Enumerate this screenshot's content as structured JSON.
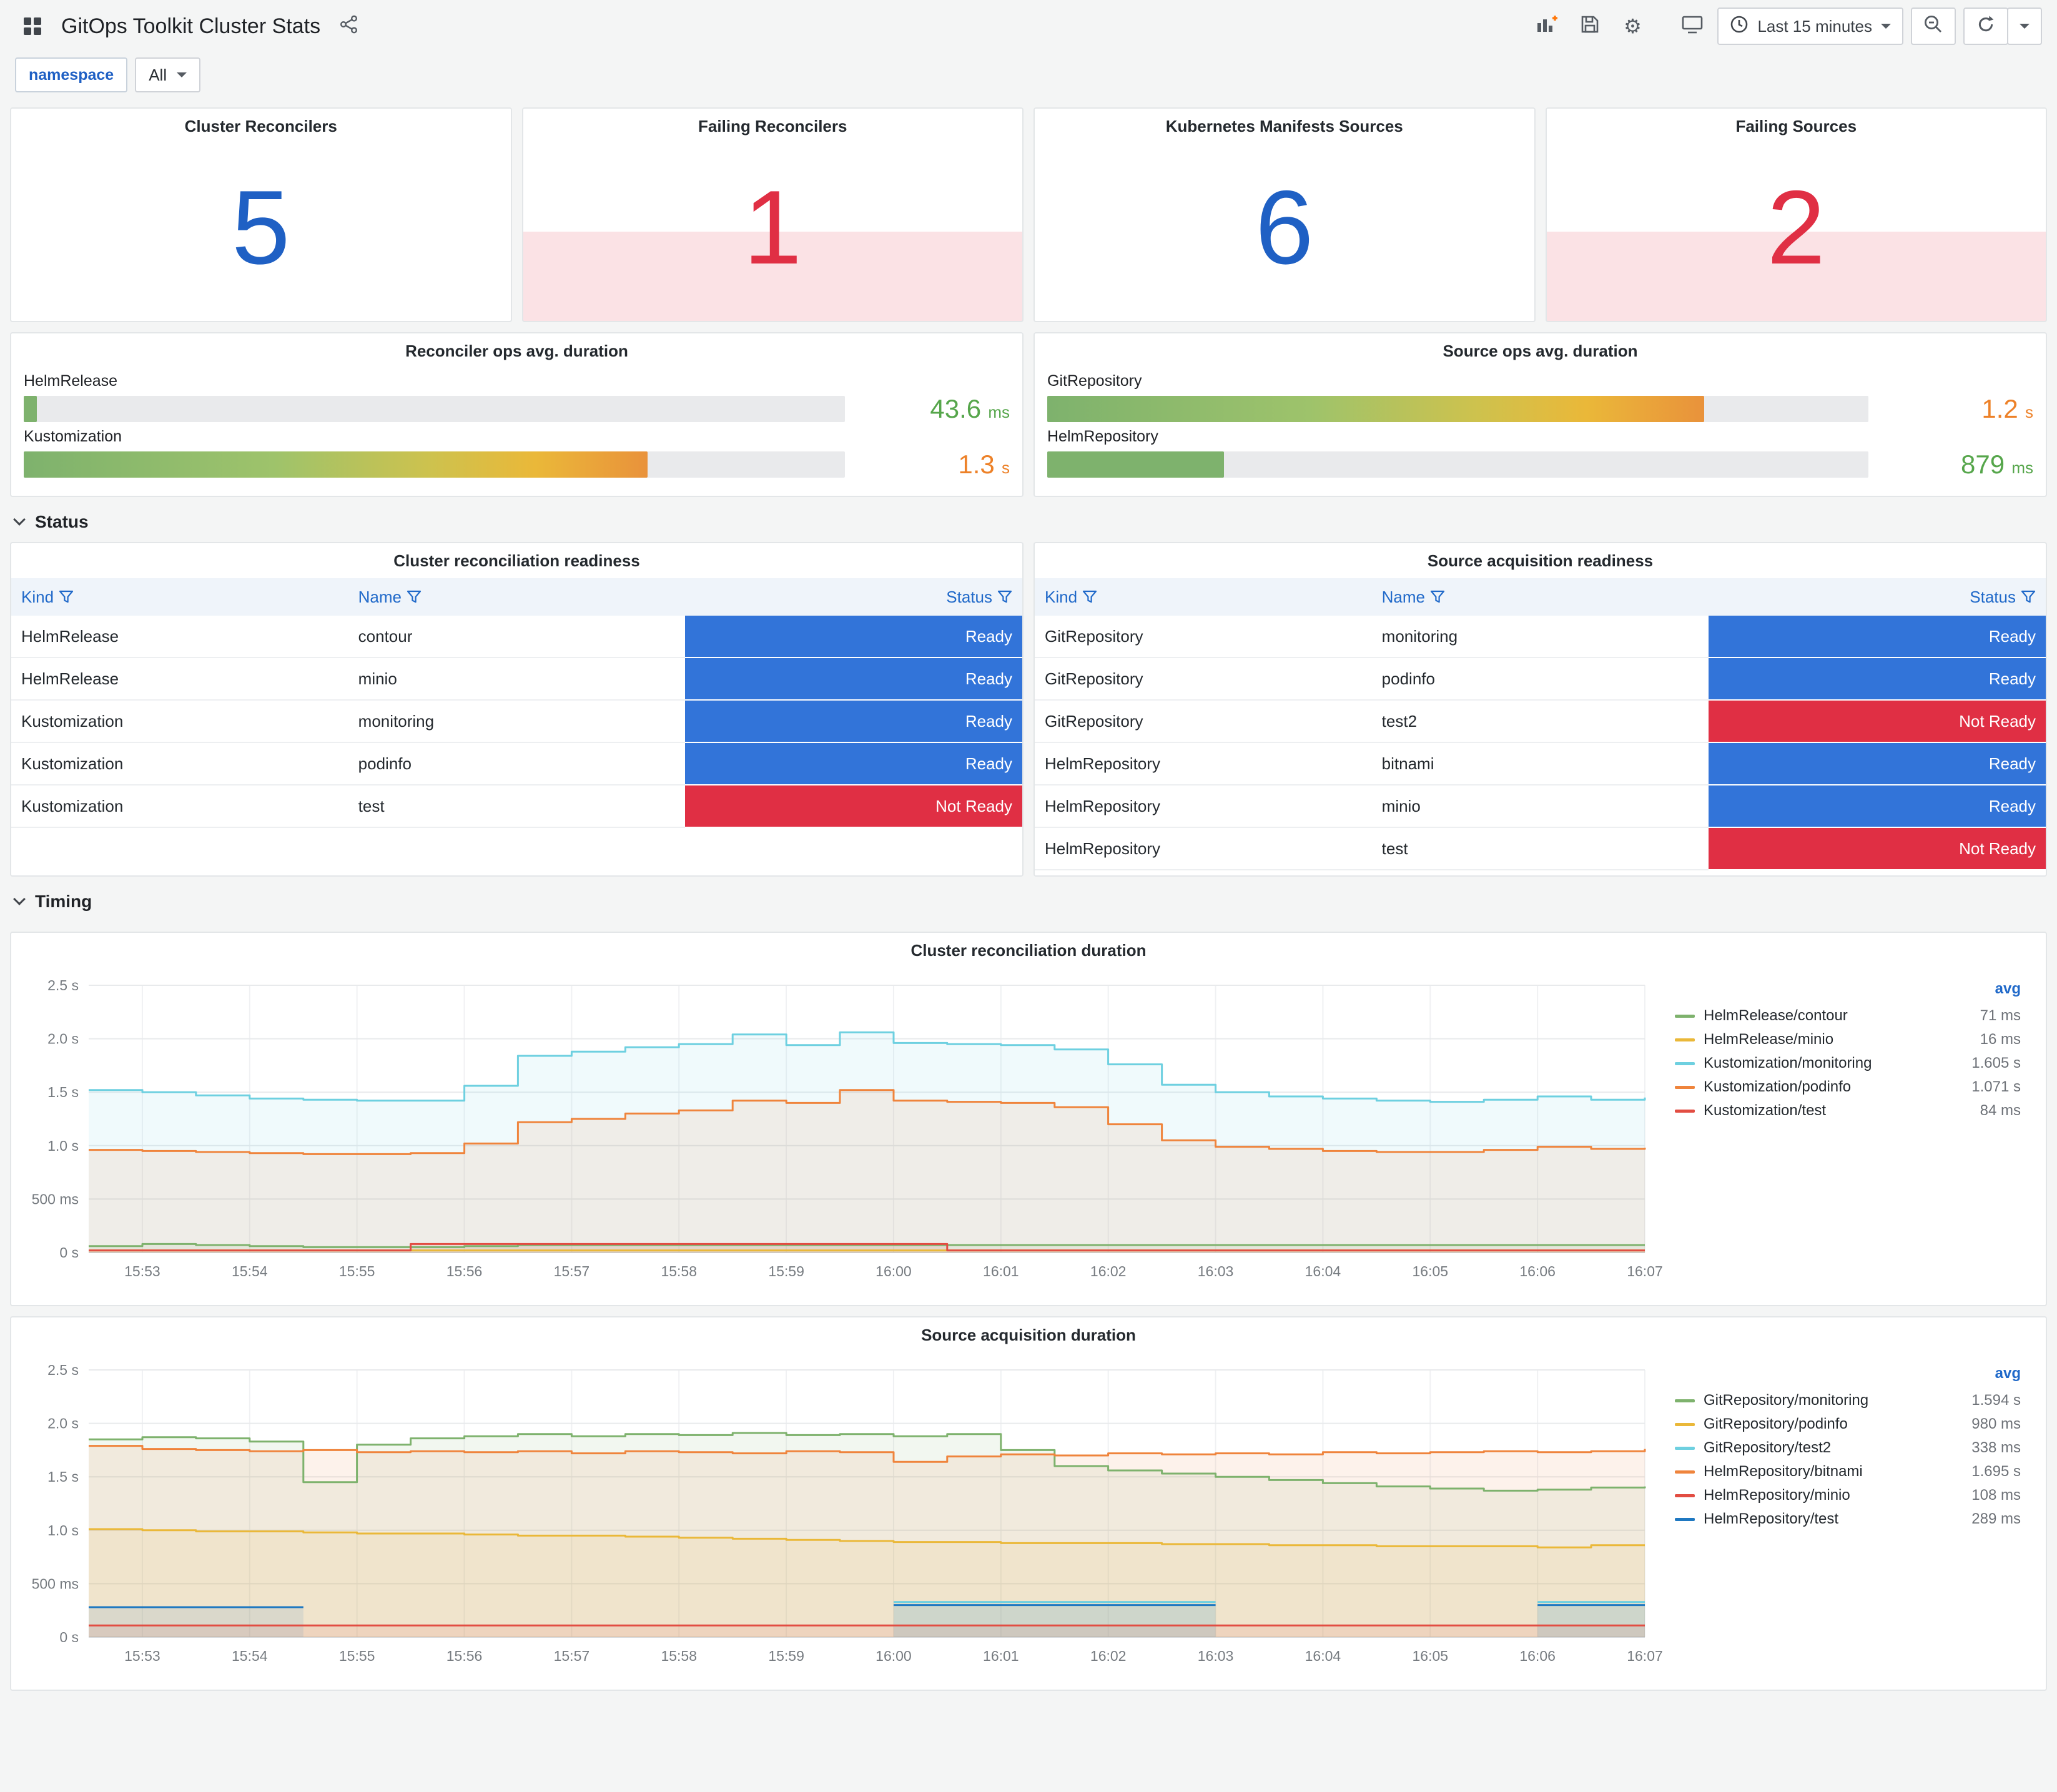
{
  "header": {
    "title": "GitOps Toolkit Cluster Stats",
    "time_picker": "Last 15 minutes"
  },
  "variables": {
    "namespace_label": "namespace",
    "namespace_value": "All"
  },
  "colors": {
    "accent_blue": "#1F60C4",
    "alert_red": "#E02F44",
    "ready_bg": "#3274D9",
    "not_ready_bg": "#E02F44",
    "value_green": "#56A64B",
    "value_orange": "#ED8128",
    "alert_band": "rgba(224,47,68,0.14)"
  },
  "stats": [
    {
      "title": "Cluster Reconcilers",
      "value": "5",
      "state": "ok"
    },
    {
      "title": "Failing Reconcilers",
      "value": "1",
      "state": "alert"
    },
    {
      "title": "Kubernetes Manifests Sources",
      "value": "6",
      "state": "ok"
    },
    {
      "title": "Failing Sources",
      "value": "2",
      "state": "alert"
    }
  ],
  "gauges": [
    {
      "title": "Reconciler ops avg. duration",
      "rows": [
        {
          "label": "HelmRelease",
          "value": "43.6",
          "unit": "ms",
          "pct": 1.6,
          "bar": "green",
          "value_color": "green"
        },
        {
          "label": "Kustomization",
          "value": "1.3",
          "unit": "s",
          "pct": 76,
          "bar": "grad",
          "value_color": "orange"
        }
      ]
    },
    {
      "title": "Source ops avg. duration",
      "rows": [
        {
          "label": "GitRepository",
          "value": "1.2",
          "unit": "s",
          "pct": 80,
          "bar": "grad",
          "value_color": "orange"
        },
        {
          "label": "HelmRepository",
          "value": "879",
          "unit": "ms",
          "pct": 21.5,
          "bar": "green",
          "value_color": "green"
        }
      ]
    }
  ],
  "sections": {
    "status": "Status",
    "timing": "Timing"
  },
  "tables": [
    {
      "title": "Cluster reconciliation readiness",
      "columns": [
        "Kind",
        "Name",
        "Status"
      ],
      "rows": [
        [
          "HelmRelease",
          "contour",
          "Ready"
        ],
        [
          "HelmRelease",
          "minio",
          "Ready"
        ],
        [
          "Kustomization",
          "monitoring",
          "Ready"
        ],
        [
          "Kustomization",
          "podinfo",
          "Ready"
        ],
        [
          "Kustomization",
          "test",
          "Not Ready"
        ]
      ]
    },
    {
      "title": "Source acquisition readiness",
      "columns": [
        "Kind",
        "Name",
        "Status"
      ],
      "rows": [
        [
          "GitRepository",
          "monitoring",
          "Ready"
        ],
        [
          "GitRepository",
          "podinfo",
          "Ready"
        ],
        [
          "GitRepository",
          "test2",
          "Not Ready"
        ],
        [
          "HelmRepository",
          "bitnami",
          "Ready"
        ],
        [
          "HelmRepository",
          "minio",
          "Ready"
        ],
        [
          "HelmRepository",
          "test",
          "Not Ready"
        ]
      ]
    }
  ],
  "chart_data": [
    {
      "type": "line",
      "title": "Cluster reconciliation duration",
      "y_unit": "seconds",
      "ylim": [
        0,
        2.5
      ],
      "ytick_values": [
        0,
        0.5,
        1.0,
        1.5,
        2.0,
        2.5
      ],
      "ytick_labels": [
        "0 s",
        "500 ms",
        "1.0 s",
        "1.5 s",
        "2.0 s",
        "2.5 s"
      ],
      "x_ticks": [
        "15:53",
        "15:54",
        "15:55",
        "15:56",
        "15:57",
        "15:58",
        "15:59",
        "16:00",
        "16:01",
        "16:02",
        "16:03",
        "16:04",
        "16:05",
        "16:06",
        "16:07"
      ],
      "legend_header": "avg",
      "legend_position": "right",
      "grid": true,
      "series": [
        {
          "name": "HelmRelease/contour",
          "avg": "71 ms",
          "color": "#7EB26D",
          "values": [
            0.06,
            0.08,
            0.07,
            0.06,
            0.05,
            0.05,
            0.05,
            0.06,
            0.07,
            0.07,
            0.07,
            0.07,
            0.07,
            0.07,
            0.07,
            0.07,
            0.07,
            0.07,
            0.07,
            0.07,
            0.07,
            0.07,
            0.07,
            0.07,
            0.07,
            0.07,
            0.07,
            0.07,
            0.07,
            0.07
          ]
        },
        {
          "name": "HelmRelease/minio",
          "avg": "16 ms",
          "color": "#EAB839",
          "values": [
            0.02,
            0.02,
            0.02,
            0.02,
            0.02,
            0.02,
            0.02,
            0.02,
            0.02,
            0.02,
            0.02,
            0.02,
            0.02,
            0.02,
            0.02,
            0.02,
            0.02,
            0.02,
            0.02,
            0.02,
            0.02,
            0.02,
            0.02,
            0.02,
            0.02,
            0.02,
            0.02,
            0.02,
            0.02,
            0.02
          ]
        },
        {
          "name": "Kustomization/monitoring",
          "avg": "1.605 s",
          "color": "#6ED0E0",
          "values": [
            1.52,
            1.5,
            1.47,
            1.44,
            1.43,
            1.42,
            1.42,
            1.56,
            1.84,
            1.88,
            1.92,
            1.95,
            2.04,
            1.94,
            2.06,
            1.96,
            1.95,
            1.94,
            1.9,
            1.76,
            1.57,
            1.5,
            1.46,
            1.44,
            1.42,
            1.41,
            1.43,
            1.46,
            1.43,
            1.45
          ]
        },
        {
          "name": "Kustomization/podinfo",
          "avg": "1.071 s",
          "color": "#EF843C",
          "values": [
            0.96,
            0.95,
            0.94,
            0.93,
            0.92,
            0.92,
            0.93,
            1.02,
            1.22,
            1.25,
            1.3,
            1.33,
            1.42,
            1.4,
            1.52,
            1.42,
            1.41,
            1.4,
            1.36,
            1.2,
            1.05,
            0.99,
            0.97,
            0.95,
            0.94,
            0.94,
            0.96,
            0.99,
            0.97,
            0.98
          ]
        },
        {
          "name": "Kustomization/test",
          "avg": "84 ms",
          "color": "#E24D42",
          "values": [
            0.02,
            0.02,
            0.02,
            0.02,
            0.02,
            0.02,
            0.08,
            0.08,
            0.08,
            0.08,
            0.08,
            0.08,
            0.08,
            0.08,
            0.08,
            0.08,
            0.02,
            0.02,
            0.02,
            0.02,
            0.02,
            0.02,
            0.02,
            0.02,
            0.02,
            0.02,
            0.02,
            0.02,
            0.02,
            0.02
          ]
        }
      ]
    },
    {
      "type": "line",
      "title": "Source acquisition duration",
      "y_unit": "seconds",
      "ylim": [
        0,
        2.5
      ],
      "ytick_values": [
        0,
        0.5,
        1.0,
        1.5,
        2.0,
        2.5
      ],
      "ytick_labels": [
        "0 s",
        "500 ms",
        "1.0 s",
        "1.5 s",
        "2.0 s",
        "2.5 s"
      ],
      "x_ticks": [
        "15:53",
        "15:54",
        "15:55",
        "15:56",
        "15:57",
        "15:58",
        "15:59",
        "16:00",
        "16:01",
        "16:02",
        "16:03",
        "16:04",
        "16:05",
        "16:06",
        "16:07"
      ],
      "legend_header": "avg",
      "legend_position": "right",
      "grid": true,
      "series": [
        {
          "name": "GitRepository/monitoring",
          "avg": "1.594 s",
          "color": "#7EB26D",
          "values": [
            1.85,
            1.87,
            1.86,
            1.83,
            1.45,
            1.8,
            1.86,
            1.88,
            1.9,
            1.88,
            1.9,
            1.89,
            1.91,
            1.89,
            1.9,
            1.88,
            1.9,
            1.75,
            1.6,
            1.56,
            1.53,
            1.5,
            1.47,
            1.44,
            1.41,
            1.39,
            1.37,
            1.38,
            1.4,
            1.41
          ]
        },
        {
          "name": "GitRepository/podinfo",
          "avg": "980 ms",
          "color": "#EAB839",
          "values": [
            1.01,
            1.0,
            0.99,
            0.99,
            0.98,
            0.97,
            0.97,
            0.96,
            0.95,
            0.95,
            0.94,
            0.93,
            0.92,
            0.91,
            0.9,
            0.89,
            0.89,
            0.88,
            0.88,
            0.88,
            0.87,
            0.87,
            0.86,
            0.86,
            0.85,
            0.85,
            0.85,
            0.84,
            0.86,
            0.86
          ]
        },
        {
          "name": "GitRepository/test2",
          "avg": "338 ms",
          "color": "#6ED0E0",
          "values": [
            null,
            null,
            null,
            null,
            null,
            null,
            null,
            null,
            null,
            null,
            null,
            null,
            null,
            null,
            null,
            0.33,
            0.33,
            0.33,
            0.33,
            0.33,
            0.33,
            0.33,
            null,
            null,
            null,
            null,
            null,
            0.33,
            0.33,
            0.33
          ]
        },
        {
          "name": "HelmRepository/bitnami",
          "avg": "1.695 s",
          "color": "#EF843C",
          "values": [
            1.79,
            1.76,
            1.75,
            1.74,
            1.75,
            1.73,
            1.74,
            1.73,
            1.74,
            1.72,
            1.74,
            1.73,
            1.72,
            1.74,
            1.73,
            1.64,
            1.69,
            1.71,
            1.7,
            1.72,
            1.71,
            1.72,
            1.71,
            1.73,
            1.72,
            1.73,
            1.74,
            1.73,
            1.74,
            1.76
          ]
        },
        {
          "name": "HelmRepository/minio",
          "avg": "108 ms",
          "color": "#E24D42",
          "values": [
            0.11,
            0.11,
            0.11,
            0.11,
            0.11,
            0.11,
            0.11,
            0.11,
            0.11,
            0.11,
            0.11,
            0.11,
            0.11,
            0.11,
            0.11,
            0.11,
            0.11,
            0.11,
            0.11,
            0.11,
            0.11,
            0.11,
            0.11,
            0.11,
            0.11,
            0.11,
            0.11,
            0.11,
            0.11,
            0.11
          ]
        },
        {
          "name": "HelmRepository/test",
          "avg": "289 ms",
          "color": "#1F78C1",
          "values": [
            0.28,
            0.28,
            0.28,
            0.28,
            0.28,
            null,
            null,
            null,
            null,
            null,
            null,
            null,
            null,
            null,
            null,
            0.3,
            0.3,
            0.3,
            0.3,
            0.3,
            0.3,
            0.3,
            null,
            null,
            null,
            null,
            null,
            0.3,
            0.3,
            0.3
          ]
        }
      ]
    }
  ]
}
